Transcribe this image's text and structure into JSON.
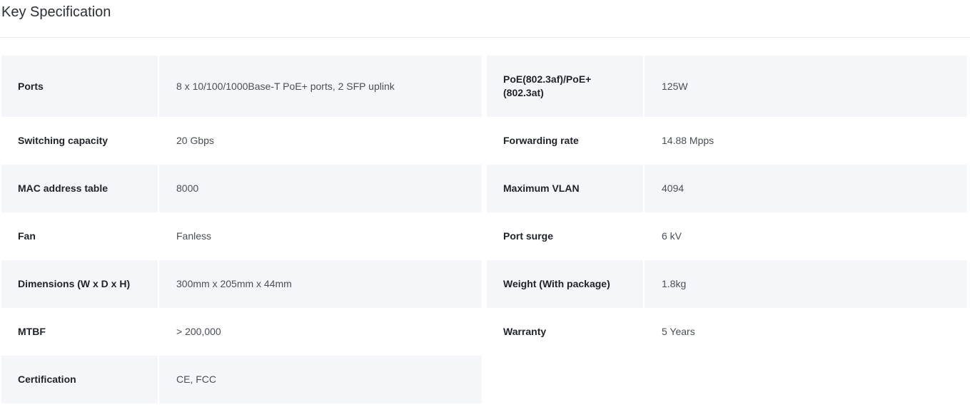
{
  "page": {
    "title": "Key Specification"
  },
  "spec_left": [
    {
      "label": "Ports",
      "value": "8 x 10/100/1000Base-T PoE+ ports, 2 SFP uplink"
    },
    {
      "label": "Switching capacity",
      "value": "20 Gbps"
    },
    {
      "label": "MAC address table",
      "value": "8000"
    },
    {
      "label": "Fan",
      "value": "Fanless"
    },
    {
      "label": "Dimensions (W x D x H)",
      "value": "300mm x 205mm x 44mm"
    },
    {
      "label": "MTBF",
      "value": "> 200,000"
    },
    {
      "label": "Certification",
      "value": "CE, FCC"
    }
  ],
  "spec_right": [
    {
      "label": "PoE(802.3af)/PoE+ (802.3at)",
      "value": "125W"
    },
    {
      "label": "Forwarding rate",
      "value": "14.88 Mpps"
    },
    {
      "label": "Maximum VLAN",
      "value": "4094"
    },
    {
      "label": "Port surge",
      "value": "6 kV"
    },
    {
      "label": "Weight (With package)",
      "value": "1.8kg"
    },
    {
      "label": "Warranty",
      "value": "5 Years"
    }
  ]
}
